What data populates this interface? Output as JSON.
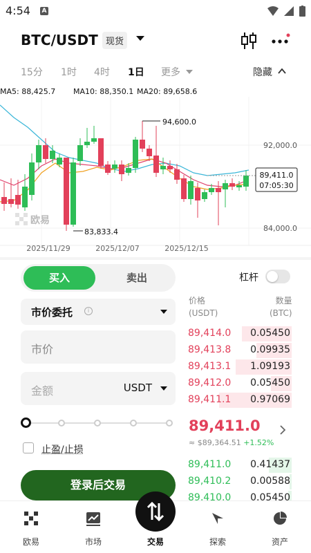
{
  "status_bar": {
    "time": "4:54",
    "notification_icon": "A"
  },
  "header": {
    "pair": "BTC/USDT",
    "market_type": "现货"
  },
  "tabs": {
    "items": [
      "15分",
      "1时",
      "4时",
      "1日",
      "更多"
    ],
    "active": "1日",
    "hide_label": "隐藏"
  },
  "ma_legend": {
    "ma5": "MA5: 88,425.7",
    "ma10": "MA10: 88,350.1",
    "ma20": "MA20: 89,658.6",
    "colors": {
      "ma5": "#f0a020",
      "ma10": "#e0406a",
      "ma20": "#3ab6d8"
    }
  },
  "chart_data": {
    "type": "candlestick",
    "price_axis_labels": [
      "92,000.0",
      "84,000.0"
    ],
    "date_labels": [
      "2025/11/29",
      "2025/12/07",
      "2025/12/15"
    ],
    "high_annotation": "94,600.0",
    "low_annotation": "83,833.4",
    "current_price": "89,411.0",
    "countdown": "07:05:30",
    "watermark": "欧易",
    "colors": {
      "up": "#2ebd57",
      "down": "#e2405a"
    }
  },
  "trade": {
    "buy_label": "买入",
    "sell_label": "卖出",
    "leverage_label": "杠杆",
    "leverage_enabled": false,
    "order_type": "市价委托",
    "price_placeholder": "市价",
    "amount_placeholder": "金额",
    "amount_unit": "USDT",
    "tpsl_label": "止盈/止损",
    "login_button": "登录后交易"
  },
  "orderbook": {
    "price_header": "价格",
    "price_unit": "(USDT)",
    "qty_header": "数量",
    "qty_unit": "(BTC)",
    "asks": [
      {
        "price": "89,414.0",
        "qty": "0.05450",
        "depth": 0.48
      },
      {
        "price": "89,413.8",
        "qty": "0.09935",
        "depth": 0.34
      },
      {
        "price": "89,413.1",
        "qty": "1.09193",
        "depth": 0.54
      },
      {
        "price": "89,412.0",
        "qty": "0.05450",
        "depth": 0.2
      },
      {
        "price": "89,411.1",
        "qty": "0.97069",
        "depth": 0.7
      }
    ],
    "last_price": "89,411.0",
    "last_price_usd": "≈ $89,364.51",
    "change_pct": "+1.52%",
    "bids": [
      {
        "price": "89,411.0",
        "qty": "0.41437",
        "depth": 0.22
      },
      {
        "price": "89,410.2",
        "qty": "0.00588",
        "depth": 0.02
      },
      {
        "price": "89,410.0",
        "qty": "0.05450",
        "depth": 0.03
      }
    ]
  },
  "bottom_nav": {
    "items": [
      "欧易",
      "市场",
      "交易",
      "探索",
      "资产"
    ],
    "active": "交易"
  }
}
